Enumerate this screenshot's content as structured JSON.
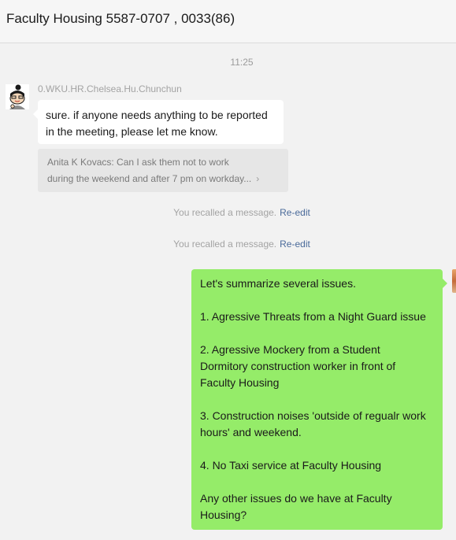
{
  "header": {
    "title": "Faculty Housing 5587-0707 , 0033(86)"
  },
  "conversation": {
    "timestamp": "11:25",
    "incoming": {
      "sender": "0.WKU.HR.Chelsea.Hu.Chunchun",
      "avatar_icon": "cartoon-avatar-icon",
      "text_lines": [
        "sure. if anyone needs anything to be reported",
        "in the meeting, please let me know."
      ],
      "quote_lines": [
        "Anita K Kovacs: Can I ask them not to work",
        "during the weekend and after 7 pm on workday..."
      ],
      "quote_arrow": "›"
    },
    "recalls": [
      {
        "text": "You recalled a message.",
        "action": "Re-edit"
      },
      {
        "text": "You recalled a message.",
        "action": "Re-edit"
      }
    ],
    "outgoing": {
      "lines": [
        "Let's summarize several issues.",
        "",
        "1. Agressive Threats from a Night Guard issue",
        "",
        "2. Agressive Mockery from a Student",
        "Dormitory construction worker in front of",
        "Faculty Housing",
        "",
        "3. Construction noises 'outside of regualr work",
        "hours' and weekend.",
        "",
        "4. No Taxi service at Faculty Housing",
        "",
        "Any other issues do we have at Faculty",
        "Housing?"
      ]
    }
  },
  "colors": {
    "outgoing_bubble": "#95ec69",
    "incoming_bubble": "#ffffff",
    "background": "#f2f2f2",
    "link": "#4a6a9a"
  }
}
